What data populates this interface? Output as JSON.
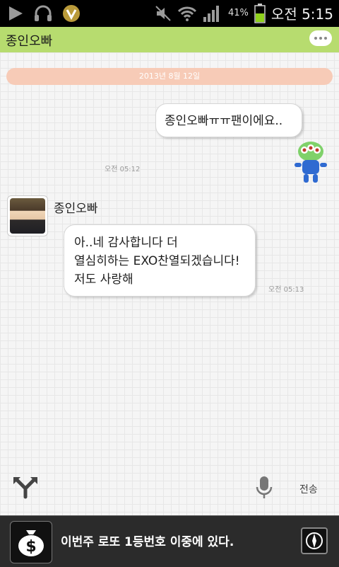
{
  "status_bar": {
    "battery_percent": "41%",
    "time": "오전 5:15",
    "icons": [
      "play-icon",
      "headphones-icon",
      "v-app-icon",
      "mute-icon",
      "wifi-icon",
      "signal-icon",
      "battery-icon"
    ]
  },
  "header": {
    "title": "종인오빠",
    "menu_icon": "speech-bubble-menu-icon"
  },
  "chat": {
    "date_divider": "2013년 8월 12일",
    "messages": [
      {
        "from": "me",
        "text": "종인오빠ㅠㅠ팬이에요..",
        "time": "오전 05:12"
      },
      {
        "from": "them",
        "sender": "종인오빠",
        "lines": [
          "아..네 감사합니다 더",
          "열심히하는 EXO찬열되겠습니다!",
          "저도 사랑해"
        ],
        "time": "오전 05:13"
      }
    ]
  },
  "input_bar": {
    "send_label": "전송",
    "share_icon": "share-arrows-icon",
    "mic_icon": "microphone-icon"
  },
  "ad": {
    "text": "이번주 로또 1등번호 이중에 있다.",
    "icon": "money-bag-icon",
    "compass_icon": "compass-icon"
  },
  "colors": {
    "header": "#b7dc6f",
    "date_pill": "#f7cbb7",
    "ad_background": "#2b2b2b"
  }
}
